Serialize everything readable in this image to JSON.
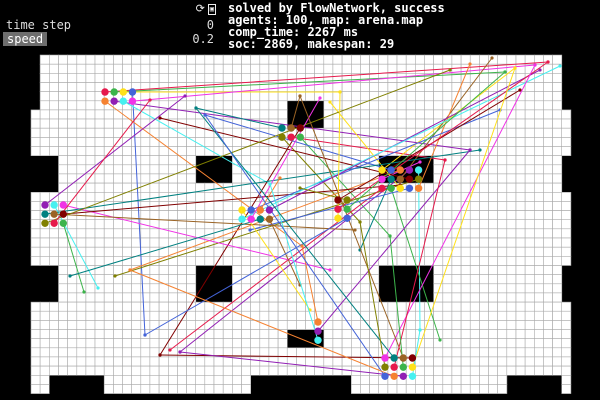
{
  "panel": {
    "time_step_label": "time step",
    "time_step_value": "0",
    "speed_label": "speed",
    "speed_value": "0.2",
    "icons": [
      "refresh-icon",
      "screenshot-icon"
    ]
  },
  "info": {
    "line1": "solved by FlowNetwork, success",
    "line2": "agents: 100, map: arena.map",
    "line3": "comp_time: 2267 ms",
    "line4": "soc: 2869, makespan: 29"
  },
  "colors": {
    "background": "#000000",
    "free_cell": "#ffffff",
    "grid_line": "#a8a8a8",
    "agent_palette": [
      "#e6194b",
      "#3cb44b",
      "#ffe119",
      "#4363d8",
      "#f58231",
      "#911eb4",
      "#46f0f0",
      "#f032e6",
      "#008080",
      "#9a6324",
      "#800000",
      "#808000"
    ]
  }
}
